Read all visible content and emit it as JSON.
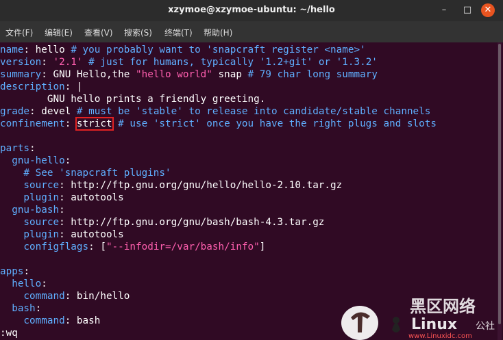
{
  "window": {
    "title": "xzymoe@xzymoe-ubuntu: ~/hello",
    "controls": {
      "minimize": "–",
      "maximize": "□",
      "close": "✕"
    }
  },
  "menu": [
    "文件(F)",
    "编辑(E)",
    "查看(V)",
    "搜索(S)",
    "终端(T)",
    "帮助(H)"
  ],
  "editor": {
    "l1": {
      "key": "name",
      "val": " hello ",
      "cm": "# you probably want to 'snapcraft register <name>'"
    },
    "l2": {
      "key": "version",
      "sp": " ",
      "str": "'2.1'",
      "cm": " # just for humans, typically '1.2+git' or '1.3.2'"
    },
    "l3": {
      "key": "summary",
      "val": " GNU Hello,the ",
      "str": "\"hello world\"",
      "val2": " snap ",
      "cm": "# 79 char long summary"
    },
    "l4": {
      "key": "description",
      "val": " |"
    },
    "l5": {
      "val": "        GNU hello prints a friendly greeting."
    },
    "l6": {
      "key": "grade",
      "val": " devel ",
      "cm": "# must be 'stable' to release into candidate/stable channels"
    },
    "l7": {
      "key": "confinement",
      "sp": " ",
      "hl": "strict",
      "cm": " # use 'strict' once you have the right plugs and slots"
    },
    "l9": {
      "key": "parts"
    },
    "l10": {
      "key": "  gnu-hello"
    },
    "l11": {
      "cm": "    # See 'snapcraft plugins'"
    },
    "l12": {
      "key": "    source",
      "val": " http://ftp.gnu.org/gnu/hello/hello-2.10.tar.gz"
    },
    "l13": {
      "key": "    plugin",
      "val": " autotools"
    },
    "l14": {
      "key": "  gnu-bash"
    },
    "l15": {
      "key": "    source",
      "val": " http://ftp.gnu.org/gnu/bash/bash-4.3.tar.gz"
    },
    "l16": {
      "key": "    plugin",
      "val": " autotools"
    },
    "l17": {
      "key": "    configflags",
      "val": " [",
      "str": "\"--infodir=/var/bash/info\"",
      "val2": "]"
    },
    "l19": {
      "key": "apps"
    },
    "l20": {
      "key": "  hello"
    },
    "l21": {
      "key": "    command",
      "val": " bin/hello"
    },
    "l22": {
      "key": "  bash"
    },
    "l23": {
      "key": "    command",
      "val": " bash"
    },
    "cmdline": ":wq"
  },
  "watermark": {
    "brand_cn": "黑区网络",
    "brand": "Linux",
    "brand_suffix": "公社",
    "url": "www.Linuxidc.com"
  }
}
